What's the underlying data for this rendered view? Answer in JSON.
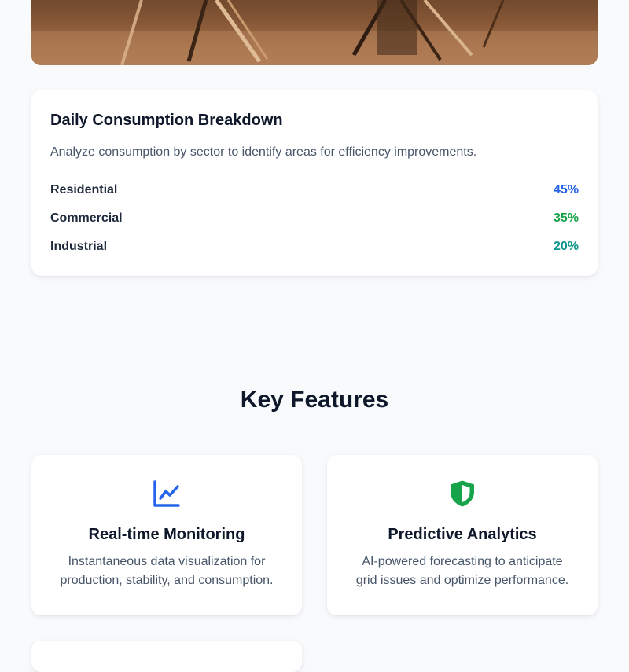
{
  "breakdown": {
    "title": "Daily Consumption Breakdown",
    "description": "Analyze consumption by sector to identify areas for efficiency improvements.",
    "rows": [
      {
        "label": "Residential",
        "value": "45%",
        "color": "#2563eb"
      },
      {
        "label": "Commercial",
        "value": "35%",
        "color": "#16a34a"
      },
      {
        "label": "Industrial",
        "value": "20%",
        "color": "#0d9488"
      }
    ]
  },
  "features": {
    "heading": "Key Features",
    "items": [
      {
        "icon": "line-chart-icon",
        "icon_color": "#2563eb",
        "title": "Real-time Monitoring",
        "description": "Instantaneous data visualization for production, stability, and consumption."
      },
      {
        "icon": "shield-icon",
        "icon_color": "#16a34a",
        "title": "Predictive Analytics",
        "description": "AI-powered forecasting to anticipate grid issues and optimize performance."
      }
    ]
  }
}
